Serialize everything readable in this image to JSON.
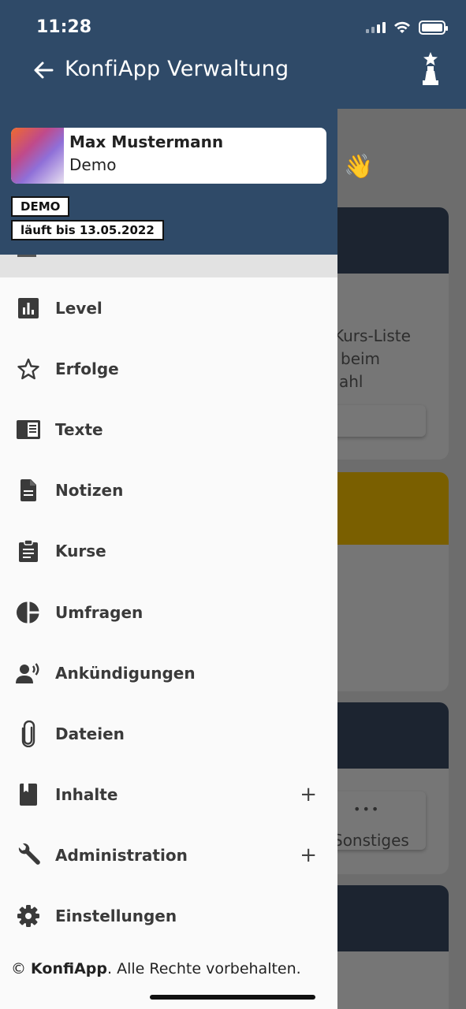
{
  "status_bar": {
    "time": "11:28"
  },
  "header": {
    "title": "KonfiApp Verwaltung"
  },
  "user": {
    "name": "Max Mustermann",
    "role": "Demo"
  },
  "badges": {
    "demo": "DEMO",
    "valid_until": "läuft bis 13.05.2022"
  },
  "menu": [
    {
      "label": "Level",
      "icon": "bar-chart-icon"
    },
    {
      "label": "Erfolge",
      "icon": "star-icon"
    },
    {
      "label": "Texte",
      "icon": "article-icon"
    },
    {
      "label": "Notizen",
      "icon": "document-icon"
    },
    {
      "label": "Kurse",
      "icon": "clipboard-icon"
    },
    {
      "label": "Umfragen",
      "icon": "pie-chart-icon"
    },
    {
      "label": "Ankündigungen",
      "icon": "speaker-person-icon"
    },
    {
      "label": "Dateien",
      "icon": "paperclip-icon"
    },
    {
      "label": "Inhalte",
      "icon": "book-icon",
      "expand": "+"
    },
    {
      "label": "Administration",
      "icon": "wrench-icon",
      "expand": "+"
    },
    {
      "label": "Einstellungen",
      "icon": "gear-icon"
    }
  ],
  "footer": {
    "symbol": "©",
    "brand": "KonfiApp",
    "rest": ". Alle Rechte vorbehalten."
  },
  "background": {
    "line1": "Kurs-Liste",
    "line2": "beim",
    "line3": "ahl",
    "sonstiges": "Sonstiges",
    "dots": "•••",
    "wave": "👋"
  },
  "colors": {
    "header": "#2f4a68",
    "accent_yellow": "#7a5f00",
    "dark_card": "#1c2430"
  }
}
